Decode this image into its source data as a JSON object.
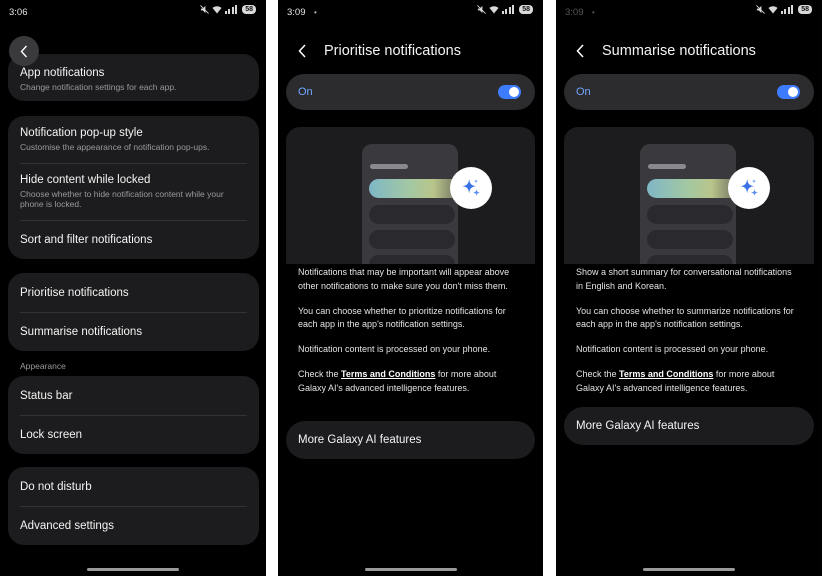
{
  "screen1": {
    "status": {
      "time": "3:06",
      "battery": "58"
    },
    "groups": [
      {
        "items": [
          {
            "title": "App notifications",
            "sub": "Change notification settings for each app."
          }
        ]
      },
      {
        "items": [
          {
            "title": "Notification pop-up style",
            "sub": "Customise the appearance of notification pop-ups."
          },
          {
            "title": "Hide content while locked",
            "sub": "Choose whether to hide notification content while your phone is locked."
          },
          {
            "title": "Sort and filter notifications",
            "sub": ""
          }
        ]
      },
      {
        "items": [
          {
            "title": "Prioritise notifications"
          },
          {
            "title": "Summarise notifications"
          }
        ]
      },
      {
        "items": [
          {
            "title": "Status bar"
          },
          {
            "title": "Lock screen"
          }
        ]
      },
      {
        "items": [
          {
            "title": "Do not disturb"
          },
          {
            "title": "Advanced settings"
          }
        ]
      }
    ],
    "section_appearance": "Appearance"
  },
  "screen2": {
    "status": {
      "time": "3:09",
      "battery": "58"
    },
    "title": "Prioritise notifications",
    "toggle_label": "On",
    "p1": "Notifications that may be important will appear above other notifications to make sure you don't miss them.",
    "p2": "You can choose whether to prioritize notifications for each app in the app's notification settings.",
    "p3": "Notification content is processed on your phone.",
    "p4_pre": "Check the ",
    "p4_link": "Terms and Conditions",
    "p4_post": " for more about Galaxy AI's advanced intelligence features.",
    "more": "More Galaxy AI features"
  },
  "screen3": {
    "status": {
      "time": "3:09",
      "battery": "58"
    },
    "title": "Summarise notifications",
    "toggle_label": "On",
    "p1": "Show a short summary for conversational notifications in English and Korean.",
    "p2": "You can choose whether to summarize notifications for each app in the app's notification settings.",
    "p3": "Notification content is processed on your phone.",
    "p4_pre": "Check the ",
    "p4_link": "Terms and Conditions",
    "p4_post": " for more about Galaxy AI's advanced intelligence features.",
    "more": "More Galaxy AI features"
  },
  "icons": [
    "back-chevron-icon",
    "mute-icon",
    "wifi-icon",
    "signal-icon",
    "battery-icon",
    "sparkle-icon"
  ],
  "colors": {
    "accent": "#3e7cff",
    "on_label": "#6fa6ff",
    "card": "#1c1c1e",
    "bg": "#000000"
  }
}
